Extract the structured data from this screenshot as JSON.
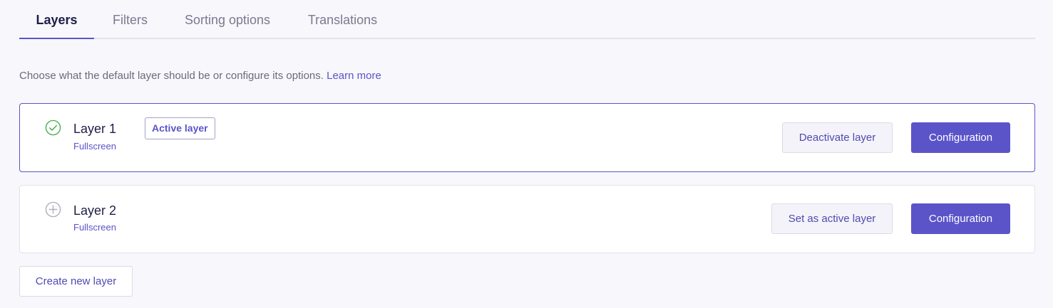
{
  "tabs": [
    {
      "label": "Layers",
      "active": true
    },
    {
      "label": "Filters",
      "active": false
    },
    {
      "label": "Sorting options",
      "active": false
    },
    {
      "label": "Translations",
      "active": false
    }
  ],
  "intro": {
    "text": "Choose what the default layer should be or configure its options.",
    "link": "Learn more"
  },
  "layers": [
    {
      "name": "Layer 1",
      "subtitle": "Fullscreen",
      "status_icon": "check-circle-icon",
      "badge": "Active layer",
      "toggle_label": "Deactivate layer",
      "config_label": "Configuration"
    },
    {
      "name": "Layer 2",
      "subtitle": "Fullscreen",
      "status_icon": "plus-circle-icon",
      "toggle_label": "Set as active layer",
      "config_label": "Configuration"
    }
  ],
  "create_button": "Create new layer",
  "colors": {
    "accent": "#5b54c9",
    "success": "#4caf50",
    "muted_icon": "#b0afbd"
  }
}
